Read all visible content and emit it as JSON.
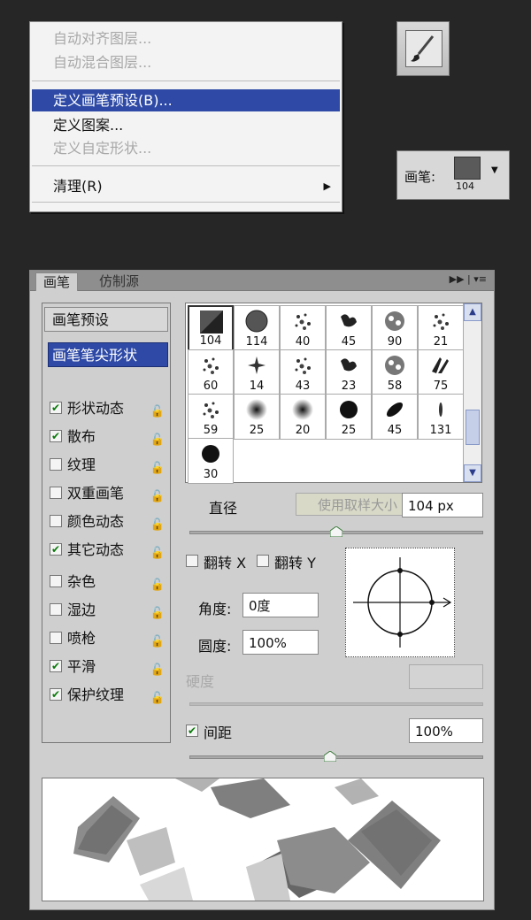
{
  "menu": {
    "items": [
      {
        "label": "自动对齐图层...",
        "state": "disabled"
      },
      {
        "label": "自动混合图层...",
        "state": "disabled"
      },
      {
        "label": "定义画笔预设(B)...",
        "state": "active"
      },
      {
        "label": "定义图案...",
        "state": "enabled"
      },
      {
        "label": "定义自定形状...",
        "state": "disabled"
      },
      {
        "label": "清理(R)",
        "state": "enabled"
      }
    ]
  },
  "tool": {
    "icon": "brush-tool-icon"
  },
  "brush_selector": {
    "label": "画笔:",
    "size": "104"
  },
  "panel": {
    "tabs": [
      {
        "label": "画笔"
      },
      {
        "label": "仿制源"
      }
    ],
    "preset_header": "画笔预设",
    "tip_header": "画笔笔尖形状",
    "options": [
      {
        "label": "形状动态",
        "checked": true
      },
      {
        "label": "散布",
        "checked": true
      },
      {
        "label": "纹理",
        "checked": false
      },
      {
        "label": "双重画笔",
        "checked": false
      },
      {
        "label": "颜色动态",
        "checked": false
      },
      {
        "label": "其它动态",
        "checked": true
      },
      {
        "label": "杂色",
        "checked": false
      },
      {
        "label": "湿边",
        "checked": false
      },
      {
        "label": "喷枪",
        "checked": false
      },
      {
        "label": "平滑",
        "checked": true
      },
      {
        "label": "保护纹理",
        "checked": true
      }
    ],
    "brushes": [
      "104",
      "114",
      "40",
      "45",
      "90",
      "21",
      "60",
      "14",
      "43",
      "23",
      "58",
      "75",
      "59",
      "25",
      "20",
      "25",
      "45",
      "131",
      "30"
    ],
    "diameter_label": "直径",
    "use_sample_size": "使用取样大小",
    "diameter_value": "104 px",
    "diameter_level": 0.5,
    "flip_x": "翻转 X",
    "flip_y": "翻转 Y",
    "angle_label": "角度:",
    "angle_value": "0度",
    "roundness_label": "圆度:",
    "roundness_value": "100%",
    "hardness_label": "硬度",
    "spacing_label": "间距",
    "spacing_checked": true,
    "spacing_value": "100%",
    "spacing_level": 0.48
  },
  "colors": {
    "accent": "#2e4aa6",
    "check": "#0a7a0a"
  }
}
